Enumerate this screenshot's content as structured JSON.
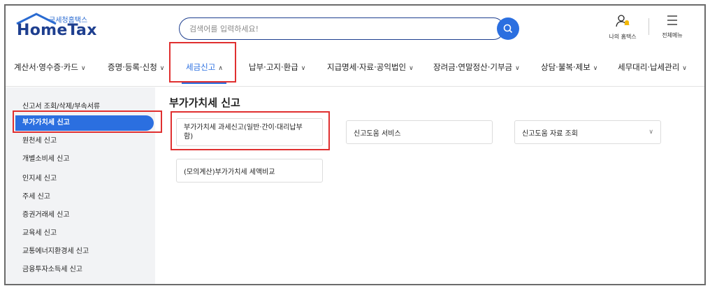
{
  "header": {
    "logo_top": "국세청홈택스",
    "logo_main": "HomeTax",
    "search_placeholder": "검색어를 입력하세요!",
    "my_hometax": "나의 홈택스",
    "all_menu": "전체메뉴"
  },
  "nav": {
    "items": [
      {
        "label": "계산서·영수증·카드"
      },
      {
        "label": "증명·등록·신청"
      },
      {
        "label": "세금신고"
      },
      {
        "label": "납부·고지·환급"
      },
      {
        "label": "지급명세·자료·공익법인"
      },
      {
        "label": "장려금·연말정산·기부금"
      },
      {
        "label": "상담·불복·제보"
      },
      {
        "label": "세무대리·납세관리"
      }
    ],
    "active_index": 2
  },
  "sidebar": {
    "items": [
      {
        "label": "신고서 조회/삭제/부속서류"
      },
      {
        "label": "부가가치세 신고"
      },
      {
        "label": "원천세 신고"
      },
      {
        "label": "개별소비세 신고"
      },
      {
        "label": "인지세 신고"
      },
      {
        "label": "주세 신고"
      },
      {
        "label": "증권거래세 신고"
      },
      {
        "label": "교육세 신고"
      },
      {
        "label": "교통에너지환경세 신고"
      },
      {
        "label": "금융투자소득세 신고"
      }
    ],
    "active_index": 1
  },
  "main": {
    "title": "부가가치세 신고",
    "cards": [
      {
        "label": "부가가치세 과세신고(일반·간이·대리납부\n함)"
      },
      {
        "label": "신고도움 서비스"
      },
      {
        "label": "신고도움 자료 조회"
      },
      {
        "label": "(모의계산)부가가치세 세액비교"
      }
    ]
  },
  "colors": {
    "brand_navy": "#1e3f8f",
    "accent_blue": "#2b6fe0",
    "highlight_red": "#e03030",
    "sidebar_bg": "#f2f3f5"
  },
  "icons": {
    "search": "search-icon",
    "user": "user-icon",
    "bell": "bell-icon",
    "menu": "hamburger-icon",
    "chevron_up": "chevron-up-icon",
    "chevron_down": "chevron-down-icon"
  }
}
